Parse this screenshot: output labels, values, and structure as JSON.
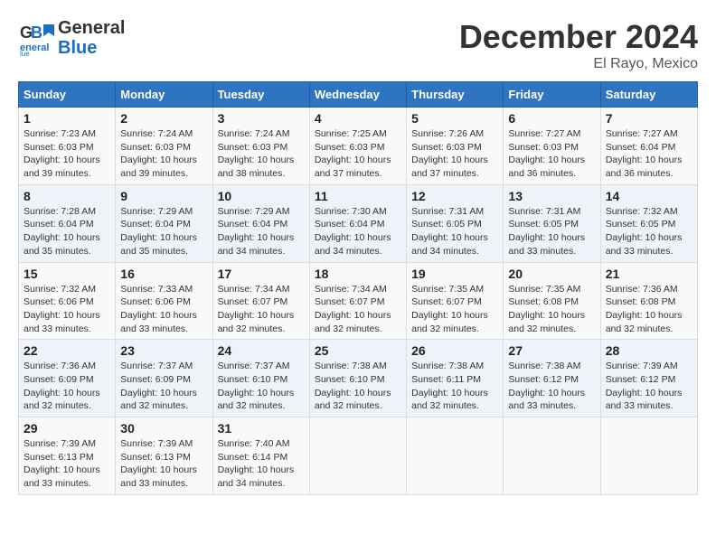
{
  "logo": {
    "line1": "General",
    "line2": "Blue"
  },
  "title": "December 2024",
  "location": "El Rayo, Mexico",
  "days_of_week": [
    "Sunday",
    "Monday",
    "Tuesday",
    "Wednesday",
    "Thursday",
    "Friday",
    "Saturday"
  ],
  "weeks": [
    [
      {
        "day": "1",
        "sunrise": "Sunrise: 7:23 AM",
        "sunset": "Sunset: 6:03 PM",
        "daylight": "Daylight: 10 hours and 39 minutes."
      },
      {
        "day": "2",
        "sunrise": "Sunrise: 7:24 AM",
        "sunset": "Sunset: 6:03 PM",
        "daylight": "Daylight: 10 hours and 39 minutes."
      },
      {
        "day": "3",
        "sunrise": "Sunrise: 7:24 AM",
        "sunset": "Sunset: 6:03 PM",
        "daylight": "Daylight: 10 hours and 38 minutes."
      },
      {
        "day": "4",
        "sunrise": "Sunrise: 7:25 AM",
        "sunset": "Sunset: 6:03 PM",
        "daylight": "Daylight: 10 hours and 37 minutes."
      },
      {
        "day": "5",
        "sunrise": "Sunrise: 7:26 AM",
        "sunset": "Sunset: 6:03 PM",
        "daylight": "Daylight: 10 hours and 37 minutes."
      },
      {
        "day": "6",
        "sunrise": "Sunrise: 7:27 AM",
        "sunset": "Sunset: 6:03 PM",
        "daylight": "Daylight: 10 hours and 36 minutes."
      },
      {
        "day": "7",
        "sunrise": "Sunrise: 7:27 AM",
        "sunset": "Sunset: 6:04 PM",
        "daylight": "Daylight: 10 hours and 36 minutes."
      }
    ],
    [
      {
        "day": "8",
        "sunrise": "Sunrise: 7:28 AM",
        "sunset": "Sunset: 6:04 PM",
        "daylight": "Daylight: 10 hours and 35 minutes."
      },
      {
        "day": "9",
        "sunrise": "Sunrise: 7:29 AM",
        "sunset": "Sunset: 6:04 PM",
        "daylight": "Daylight: 10 hours and 35 minutes."
      },
      {
        "day": "10",
        "sunrise": "Sunrise: 7:29 AM",
        "sunset": "Sunset: 6:04 PM",
        "daylight": "Daylight: 10 hours and 34 minutes."
      },
      {
        "day": "11",
        "sunrise": "Sunrise: 7:30 AM",
        "sunset": "Sunset: 6:04 PM",
        "daylight": "Daylight: 10 hours and 34 minutes."
      },
      {
        "day": "12",
        "sunrise": "Sunrise: 7:31 AM",
        "sunset": "Sunset: 6:05 PM",
        "daylight": "Daylight: 10 hours and 34 minutes."
      },
      {
        "day": "13",
        "sunrise": "Sunrise: 7:31 AM",
        "sunset": "Sunset: 6:05 PM",
        "daylight": "Daylight: 10 hours and 33 minutes."
      },
      {
        "day": "14",
        "sunrise": "Sunrise: 7:32 AM",
        "sunset": "Sunset: 6:05 PM",
        "daylight": "Daylight: 10 hours and 33 minutes."
      }
    ],
    [
      {
        "day": "15",
        "sunrise": "Sunrise: 7:32 AM",
        "sunset": "Sunset: 6:06 PM",
        "daylight": "Daylight: 10 hours and 33 minutes."
      },
      {
        "day": "16",
        "sunrise": "Sunrise: 7:33 AM",
        "sunset": "Sunset: 6:06 PM",
        "daylight": "Daylight: 10 hours and 33 minutes."
      },
      {
        "day": "17",
        "sunrise": "Sunrise: 7:34 AM",
        "sunset": "Sunset: 6:07 PM",
        "daylight": "Daylight: 10 hours and 32 minutes."
      },
      {
        "day": "18",
        "sunrise": "Sunrise: 7:34 AM",
        "sunset": "Sunset: 6:07 PM",
        "daylight": "Daylight: 10 hours and 32 minutes."
      },
      {
        "day": "19",
        "sunrise": "Sunrise: 7:35 AM",
        "sunset": "Sunset: 6:07 PM",
        "daylight": "Daylight: 10 hours and 32 minutes."
      },
      {
        "day": "20",
        "sunrise": "Sunrise: 7:35 AM",
        "sunset": "Sunset: 6:08 PM",
        "daylight": "Daylight: 10 hours and 32 minutes."
      },
      {
        "day": "21",
        "sunrise": "Sunrise: 7:36 AM",
        "sunset": "Sunset: 6:08 PM",
        "daylight": "Daylight: 10 hours and 32 minutes."
      }
    ],
    [
      {
        "day": "22",
        "sunrise": "Sunrise: 7:36 AM",
        "sunset": "Sunset: 6:09 PM",
        "daylight": "Daylight: 10 hours and 32 minutes."
      },
      {
        "day": "23",
        "sunrise": "Sunrise: 7:37 AM",
        "sunset": "Sunset: 6:09 PM",
        "daylight": "Daylight: 10 hours and 32 minutes."
      },
      {
        "day": "24",
        "sunrise": "Sunrise: 7:37 AM",
        "sunset": "Sunset: 6:10 PM",
        "daylight": "Daylight: 10 hours and 32 minutes."
      },
      {
        "day": "25",
        "sunrise": "Sunrise: 7:38 AM",
        "sunset": "Sunset: 6:10 PM",
        "daylight": "Daylight: 10 hours and 32 minutes."
      },
      {
        "day": "26",
        "sunrise": "Sunrise: 7:38 AM",
        "sunset": "Sunset: 6:11 PM",
        "daylight": "Daylight: 10 hours and 32 minutes."
      },
      {
        "day": "27",
        "sunrise": "Sunrise: 7:38 AM",
        "sunset": "Sunset: 6:12 PM",
        "daylight": "Daylight: 10 hours and 33 minutes."
      },
      {
        "day": "28",
        "sunrise": "Sunrise: 7:39 AM",
        "sunset": "Sunset: 6:12 PM",
        "daylight": "Daylight: 10 hours and 33 minutes."
      }
    ],
    [
      {
        "day": "29",
        "sunrise": "Sunrise: 7:39 AM",
        "sunset": "Sunset: 6:13 PM",
        "daylight": "Daylight: 10 hours and 33 minutes."
      },
      {
        "day": "30",
        "sunrise": "Sunrise: 7:39 AM",
        "sunset": "Sunset: 6:13 PM",
        "daylight": "Daylight: 10 hours and 33 minutes."
      },
      {
        "day": "31",
        "sunrise": "Sunrise: 7:40 AM",
        "sunset": "Sunset: 6:14 PM",
        "daylight": "Daylight: 10 hours and 34 minutes."
      },
      null,
      null,
      null,
      null
    ]
  ]
}
